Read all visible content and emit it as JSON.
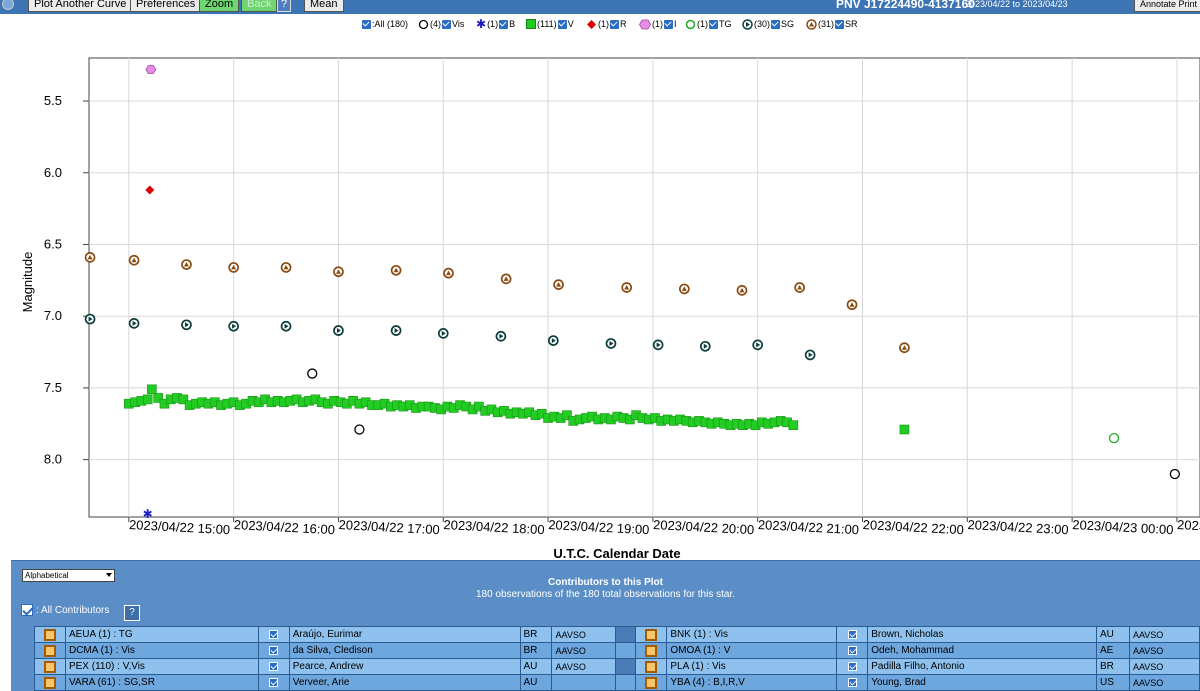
{
  "toolbar": {
    "buttons": [
      {
        "label": "Plot Another Curve"
      },
      {
        "label": "Preferences"
      },
      {
        "label": "Zoom"
      },
      {
        "label": "Back"
      },
      {
        "label": "?"
      },
      {
        "label": "Mean"
      }
    ],
    "star_name": "PNV J17224490-4137160",
    "date_range": "2023/04/22 to 2023/04/23",
    "annotate_print": "Annotate Print"
  },
  "legend": {
    "items": [
      {
        "label": ":All (180)"
      },
      {
        "label": "(4)",
        "band": "Vis",
        "color": "#000000"
      },
      {
        "label": "(1)",
        "band": "B",
        "color": "#1a1ac8"
      },
      {
        "label": "(111)",
        "band": "V",
        "color": "#22cc22"
      },
      {
        "label": "(1)",
        "band": "R",
        "color": "#dd0000"
      },
      {
        "label": "(1)",
        "band": "I",
        "color": "#e88ae8"
      },
      {
        "label": "(1)",
        "band": "TG",
        "color": "#22aa22"
      },
      {
        "label": "(30)",
        "band": "SG",
        "color": "#0d3c3c"
      },
      {
        "label": "(31)",
        "band": "SR",
        "color": "#8a4a12"
      }
    ]
  },
  "chart_data": {
    "type": "scatter",
    "ylabel": "Magnitude",
    "xlabel": "U.T.C. Calendar Date",
    "y_inverted": true,
    "ylim": [
      5.2,
      8.4
    ],
    "xlim_hours": [
      14.62,
      25.22
    ],
    "yticks": [
      "5.5",
      "6.0",
      "6.5",
      "7.0",
      "7.5",
      "8.0"
    ],
    "xticks": [
      "2023/04/22 15:00",
      "2023/04/22 16:00",
      "2023/04/22 17:00",
      "2023/04/22 18:00",
      "2023/04/22 19:00",
      "2023/04/22 20:00",
      "2023/04/22 21:00",
      "2023/04/22 22:00",
      "2023/04/22 23:00",
      "2023/04/23 00:00",
      "2023/04/23 01:00",
      "20"
    ],
    "series": [
      {
        "name": "Vis",
        "marker": "open-circle",
        "color": "#000000",
        "points": [
          [
            16.75,
            7.4
          ],
          [
            17.2,
            7.79
          ],
          [
            24.98,
            8.1
          ]
        ]
      },
      {
        "name": "B",
        "marker": "star",
        "color": "#1a1ac8",
        "points": [
          [
            15.18,
            8.38
          ]
        ]
      },
      {
        "name": "R",
        "marker": "diamond",
        "color": "#dd0000",
        "points": [
          [
            15.2,
            6.12
          ]
        ]
      },
      {
        "name": "I",
        "marker": "hexagon",
        "color": "#e88ae8",
        "points": [
          [
            15.21,
            5.28
          ]
        ]
      },
      {
        "name": "TG",
        "marker": "open-circle",
        "color": "#22aa22",
        "points": [
          [
            24.4,
            7.85
          ]
        ]
      },
      {
        "name": "SG",
        "marker": "triangle-circle",
        "color": "#0d3c3c",
        "points": [
          [
            14.63,
            7.02
          ],
          [
            15.05,
            7.05
          ],
          [
            15.55,
            7.06
          ],
          [
            16.0,
            7.07
          ],
          [
            16.5,
            7.07
          ],
          [
            17.0,
            7.1
          ],
          [
            17.55,
            7.1
          ],
          [
            18.0,
            7.12
          ],
          [
            18.55,
            7.14
          ],
          [
            19.05,
            7.17
          ],
          [
            19.6,
            7.19
          ],
          [
            20.05,
            7.2
          ],
          [
            20.5,
            7.21
          ],
          [
            21.0,
            7.2
          ],
          [
            21.5,
            7.27
          ]
        ]
      },
      {
        "name": "SR",
        "marker": "triangle-circle",
        "color": "#8a4a12",
        "points": [
          [
            14.63,
            6.59
          ],
          [
            15.05,
            6.61
          ],
          [
            15.55,
            6.64
          ],
          [
            16.0,
            6.66
          ],
          [
            16.5,
            6.66
          ],
          [
            17.0,
            6.69
          ],
          [
            17.55,
            6.68
          ],
          [
            18.05,
            6.7
          ],
          [
            18.6,
            6.74
          ],
          [
            19.1,
            6.78
          ],
          [
            19.75,
            6.8
          ],
          [
            20.3,
            6.81
          ],
          [
            20.85,
            6.82
          ],
          [
            21.4,
            6.8
          ],
          [
            21.9,
            6.92
          ],
          [
            22.4,
            7.22
          ]
        ]
      },
      {
        "name": "V",
        "marker": "square",
        "color": "#22cc22",
        "points": [
          [
            15.0,
            7.61
          ],
          [
            15.06,
            7.6
          ],
          [
            15.12,
            7.59
          ],
          [
            15.18,
            7.58
          ],
          [
            15.22,
            7.51
          ],
          [
            15.28,
            7.57
          ],
          [
            15.34,
            7.61
          ],
          [
            15.4,
            7.58
          ],
          [
            15.46,
            7.57
          ],
          [
            15.52,
            7.58
          ],
          [
            15.58,
            7.62
          ],
          [
            15.64,
            7.61
          ],
          [
            15.7,
            7.6
          ],
          [
            15.76,
            7.61
          ],
          [
            15.82,
            7.6
          ],
          [
            15.88,
            7.62
          ],
          [
            15.94,
            7.61
          ],
          [
            16.0,
            7.6
          ],
          [
            16.06,
            7.62
          ],
          [
            16.12,
            7.61
          ],
          [
            16.18,
            7.59
          ],
          [
            16.24,
            7.6
          ],
          [
            16.3,
            7.58
          ],
          [
            16.36,
            7.6
          ],
          [
            16.42,
            7.59
          ],
          [
            16.48,
            7.6
          ],
          [
            16.54,
            7.59
          ],
          [
            16.6,
            7.58
          ],
          [
            16.66,
            7.6
          ],
          [
            16.72,
            7.59
          ],
          [
            16.78,
            7.58
          ],
          [
            16.84,
            7.6
          ],
          [
            16.9,
            7.61
          ],
          [
            16.96,
            7.59
          ],
          [
            17.02,
            7.6
          ],
          [
            17.08,
            7.61
          ],
          [
            17.14,
            7.59
          ],
          [
            17.2,
            7.61
          ],
          [
            17.26,
            7.6
          ],
          [
            17.32,
            7.62
          ],
          [
            17.38,
            7.62
          ],
          [
            17.44,
            7.61
          ],
          [
            17.5,
            7.63
          ],
          [
            17.56,
            7.62
          ],
          [
            17.62,
            7.63
          ],
          [
            17.68,
            7.62
          ],
          [
            17.74,
            7.64
          ],
          [
            17.8,
            7.63
          ],
          [
            17.86,
            7.63
          ],
          [
            17.92,
            7.64
          ],
          [
            17.98,
            7.65
          ],
          [
            18.04,
            7.63
          ],
          [
            18.1,
            7.64
          ],
          [
            18.16,
            7.62
          ],
          [
            18.22,
            7.63
          ],
          [
            18.28,
            7.65
          ],
          [
            18.34,
            7.63
          ],
          [
            18.4,
            7.66
          ],
          [
            18.46,
            7.65
          ],
          [
            18.52,
            7.67
          ],
          [
            18.58,
            7.66
          ],
          [
            18.64,
            7.68
          ],
          [
            18.7,
            7.67
          ],
          [
            18.76,
            7.68
          ],
          [
            18.82,
            7.67
          ],
          [
            18.88,
            7.69
          ],
          [
            18.94,
            7.68
          ],
          [
            19.0,
            7.71
          ],
          [
            19.06,
            7.7
          ],
          [
            19.12,
            7.71
          ],
          [
            19.18,
            7.69
          ],
          [
            19.24,
            7.73
          ],
          [
            19.3,
            7.72
          ],
          [
            19.36,
            7.71
          ],
          [
            19.42,
            7.7
          ],
          [
            19.48,
            7.72
          ],
          [
            19.54,
            7.71
          ],
          [
            19.6,
            7.72
          ],
          [
            19.66,
            7.7
          ],
          [
            19.72,
            7.71
          ],
          [
            19.78,
            7.72
          ],
          [
            19.84,
            7.69
          ],
          [
            19.9,
            7.71
          ],
          [
            19.96,
            7.72
          ],
          [
            20.02,
            7.71
          ],
          [
            20.08,
            7.73
          ],
          [
            20.14,
            7.72
          ],
          [
            20.2,
            7.73
          ],
          [
            20.26,
            7.72
          ],
          [
            20.32,
            7.73
          ],
          [
            20.38,
            7.74
          ],
          [
            20.44,
            7.73
          ],
          [
            20.5,
            7.74
          ],
          [
            20.56,
            7.75
          ],
          [
            20.62,
            7.74
          ],
          [
            20.68,
            7.75
          ],
          [
            20.74,
            7.76
          ],
          [
            20.8,
            7.75
          ],
          [
            20.86,
            7.76
          ],
          [
            20.92,
            7.75
          ],
          [
            20.98,
            7.76
          ],
          [
            21.04,
            7.74
          ],
          [
            21.1,
            7.75
          ],
          [
            21.16,
            7.74
          ],
          [
            21.22,
            7.73
          ],
          [
            21.28,
            7.74
          ],
          [
            21.34,
            7.76
          ],
          [
            22.4,
            7.79
          ]
        ]
      }
    ]
  },
  "panel": {
    "sort_value": "Alphabetical",
    "title": "Contributors to this Plot",
    "subtitle": "180 observations of the 180 total observations for this star.",
    "all_contributors": ": All Contributors",
    "help": "?",
    "rows": [
      {
        "left": {
          "code": "AEUA (1) : TG",
          "name": "Araújo, Eurimar",
          "country": "BR",
          "org": "AAVSO"
        },
        "right": {
          "code": "BNK (1) : Vis",
          "name": "Brown, Nicholas",
          "country": "AU",
          "org": "AAVSO"
        }
      },
      {
        "left": {
          "code": "DCMA (1) : Vis",
          "name": "da Silva, Cledison",
          "country": "BR",
          "org": "AAVSO"
        },
        "right": {
          "code": "OMOA (1) : V",
          "name": "Odeh, Mohammad",
          "country": "AE",
          "org": "AAVSO"
        }
      },
      {
        "left": {
          "code": "PEX (110) : V,Vis",
          "name": "Pearce, Andrew",
          "country": "AU",
          "org": "AAVSO"
        },
        "right": {
          "code": "PLA (1) : Vis",
          "name": "Padilla Filho, Antonio",
          "country": "BR",
          "org": "AAVSO"
        }
      },
      {
        "left": {
          "code": "VARA (61) : SG,SR",
          "name": "Verveer, Arie",
          "country": "AU",
          "org": ""
        },
        "right": {
          "code": "YBA (4) : B,I,R,V",
          "name": "Young, Brad",
          "country": "US",
          "org": "AAVSO"
        }
      }
    ]
  }
}
